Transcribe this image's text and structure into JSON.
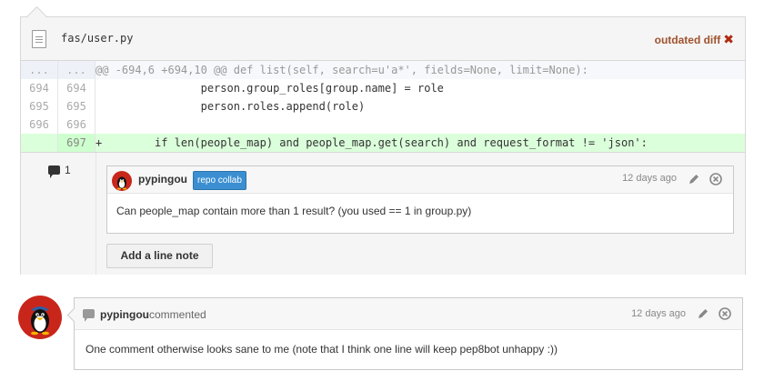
{
  "file": {
    "path": "fas/user.py",
    "status": "outdated diff",
    "status_icon": "close-x-icon"
  },
  "diff": {
    "hunk": {
      "left": "...",
      "right": "...",
      "text": "@@ -694,6 +694,10 @@ def list(self, search=u'a*', fields=None, limit=None):"
    },
    "lines": [
      {
        "left": "694",
        "right": "694",
        "text": "                person.group_roles[group.name] = role",
        "type": "context"
      },
      {
        "left": "695",
        "right": "695",
        "text": "                person.roles.append(role)",
        "type": "context"
      },
      {
        "left": "696",
        "right": "696",
        "text": "",
        "type": "context"
      },
      {
        "left": "",
        "right": "697",
        "text": "+        if len(people_map) and people_map.get(search) and request_format != 'json':",
        "type": "add"
      }
    ]
  },
  "line_comment_count": "1",
  "inline_comment": {
    "author": "pypingou",
    "badge": "repo collab",
    "time": "12 days ago",
    "body": "Can people_map contain more than 1 result? (you used == 1 in group.py)"
  },
  "add_line_note_label": "Add a line note",
  "main_comment": {
    "author": "pypingou",
    "action": "commented",
    "time": "12 days ago",
    "body": "One comment otherwise looks sane to me (note that I think one line will keep pep8bot unhappy :))"
  },
  "colors": {
    "added_line_bg": "#dbffdb",
    "badge_bg": "#3b8fd1",
    "outdated_text": "#a0522d",
    "avatar_bg": "#c9261b"
  }
}
